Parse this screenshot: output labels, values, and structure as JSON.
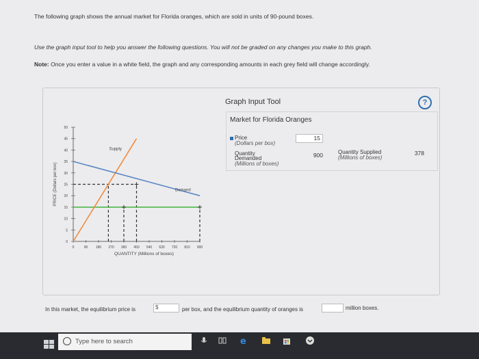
{
  "instructions": {
    "line1": "The following graph shows the annual market for Florida oranges, which are sold in units of 90-pound boxes.",
    "line2": "Use the graph input tool to help you answer the following questions. You will not be graded on any changes you make to this graph.",
    "note_label": "Note:",
    "note_text": " Once you enter a value in a white field, the graph and any corresponding amounts in each grey field will change accordingly."
  },
  "chart_data": {
    "type": "line",
    "xlabel": "QUANTITY (Millions of boxes)",
    "ylabel": "PRICE (Dollars per box)",
    "xlim": [
      0,
      900
    ],
    "ylim": [
      0,
      50
    ],
    "x_ticks": [
      "0",
      "90",
      "180",
      "270",
      "360",
      "450",
      "540",
      "630",
      "720",
      "810",
      "900"
    ],
    "y_ticks": [
      "0",
      "5",
      "10",
      "15",
      "20",
      "25",
      "30",
      "35",
      "40",
      "45",
      "50"
    ],
    "series": [
      {
        "name": "Supply",
        "color": "#f08a3c",
        "points": [
          [
            0,
            0
          ],
          [
            450,
            45
          ]
        ]
      },
      {
        "name": "Demand",
        "color": "#5b86c4",
        "points": [
          [
            0,
            35
          ],
          [
            900,
            20
          ]
        ]
      }
    ],
    "reference": {
      "price_line": {
        "y": 15,
        "x0": 0,
        "x1": 900,
        "color": "#4cb848"
      },
      "dashed_h": {
        "y": 25,
        "x0": 0,
        "x1": 450,
        "color": "#333333"
      },
      "dashed_v": [
        {
          "x": 250,
          "y0": 0,
          "y1": 25
        },
        {
          "x": 450,
          "y0": 0,
          "y1": 25
        }
      ],
      "dashed_v2": [
        {
          "x": 360,
          "y0": 0,
          "y1": 15
        },
        {
          "x": 900,
          "y0": 0,
          "y1": 15
        }
      ],
      "crosses": [
        [
          450,
          25
        ],
        [
          360,
          15
        ],
        [
          900,
          15
        ]
      ]
    }
  },
  "tool": {
    "title": "Graph Input Tool",
    "help_glyph": "?",
    "market_title": "Market for Florida Oranges",
    "price_label": "Price",
    "price_unit": "(Dollars per box)",
    "price_value": "15",
    "qd_label1": "Quantity",
    "qd_label2": "Demanded",
    "qd_unit": "(Millions of boxes)",
    "qd_value": "900",
    "qs_label": "Quantity Supplied",
    "qs_unit": "(Millions of boxes)",
    "qs_value": "378"
  },
  "question": {
    "part1": "In this market, the equilibrium price is",
    "currency": "$",
    "part2": "per box, and the equilibrium quantity of oranges is",
    "part3": "million boxes."
  },
  "taskbar": {
    "search_placeholder": "Type here to search"
  }
}
